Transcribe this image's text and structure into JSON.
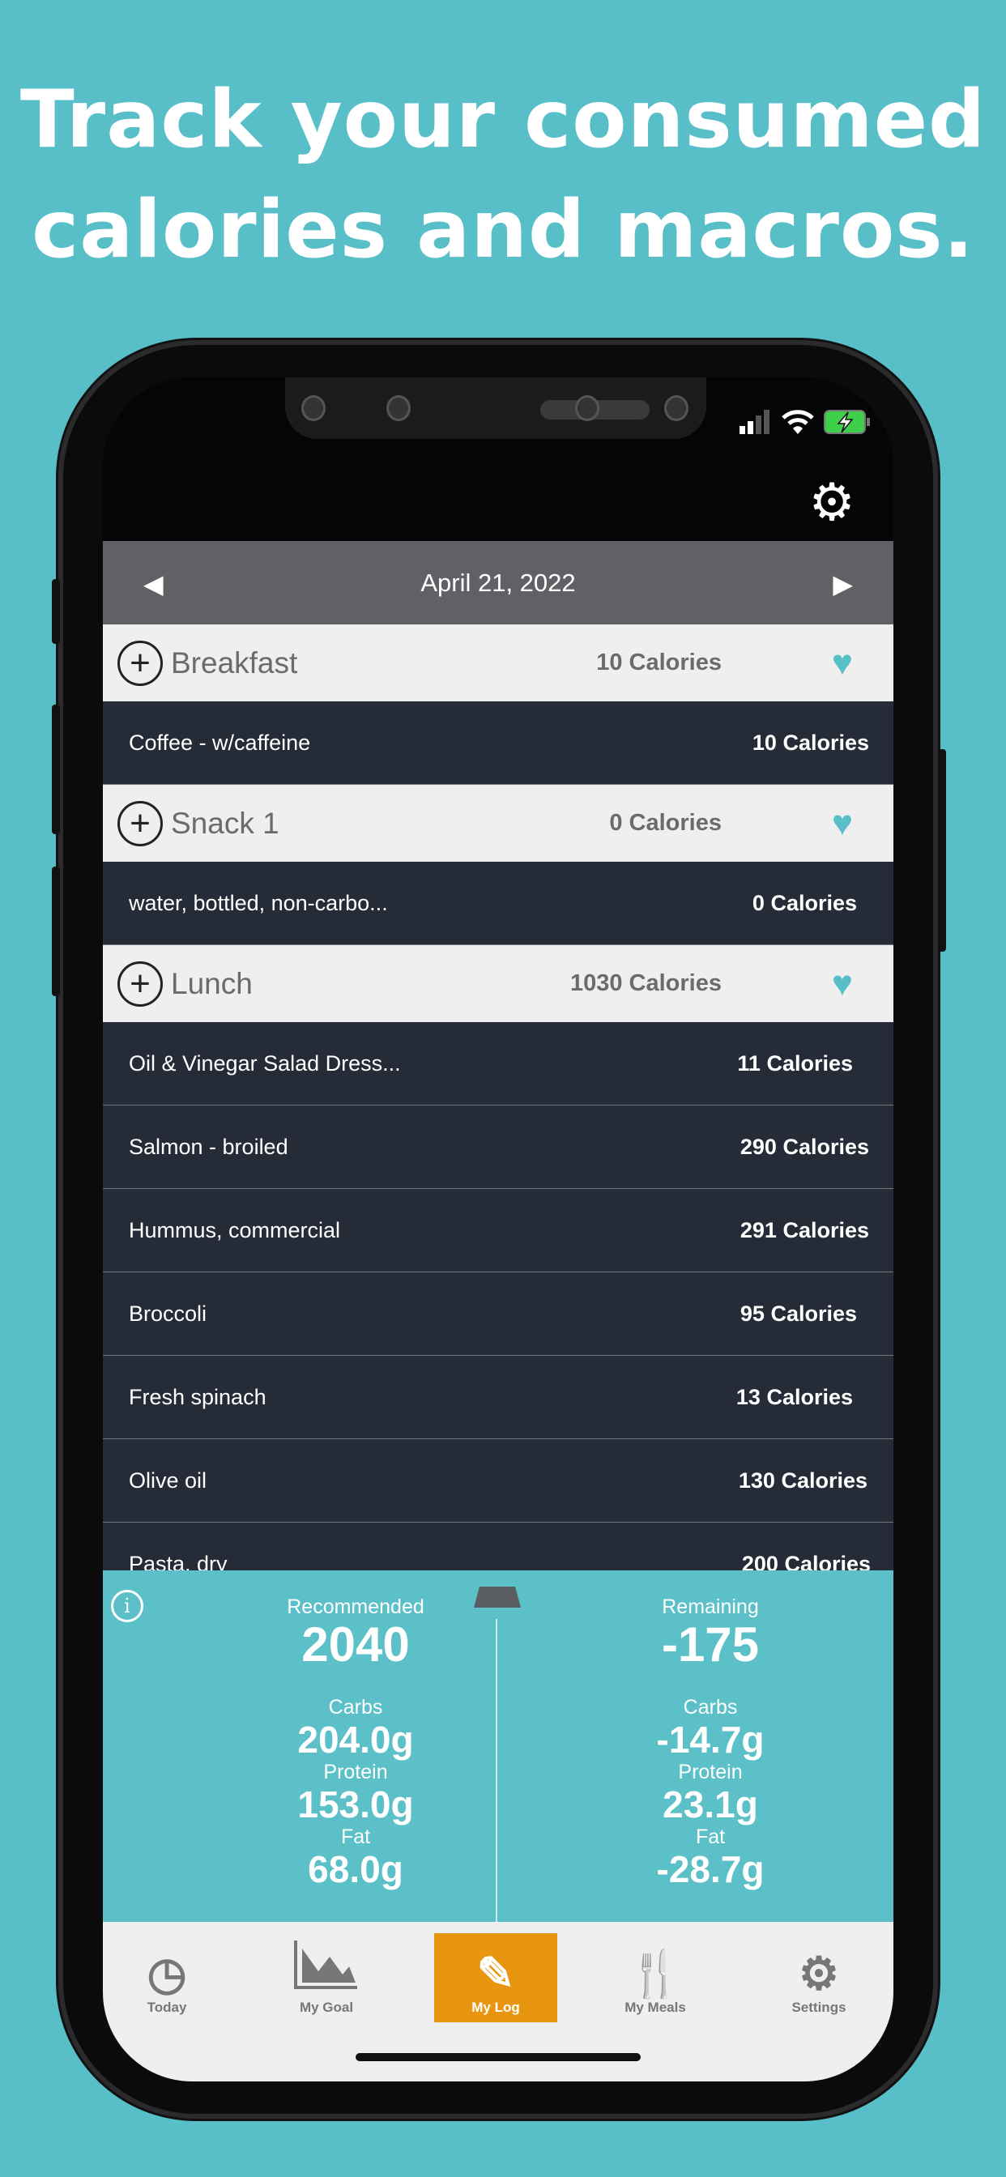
{
  "headline": {
    "line1": "Track your consumed",
    "line2": "calories and macros."
  },
  "header": {
    "date": "April 21, 2022"
  },
  "meals": [
    {
      "name": "Breakfast",
      "calories": "10 Calories",
      "items": [
        {
          "name": "Coffee - w/caffeine",
          "calories": "10 Calories"
        }
      ]
    },
    {
      "name": "Snack 1",
      "calories": "0 Calories",
      "items": [
        {
          "name": "water, bottled, non-carbo...",
          "calories": "0 Calories"
        }
      ]
    },
    {
      "name": "Lunch",
      "calories": "1030 Calories",
      "items": [
        {
          "name": "Oil & Vinegar Salad Dress...",
          "calories": "11 Calories"
        },
        {
          "name": "Salmon - broiled",
          "calories": "290 Calories"
        },
        {
          "name": "Hummus, commercial",
          "calories": "291 Calories"
        },
        {
          "name": "Broccoli",
          "calories": "95 Calories"
        },
        {
          "name": "Fresh spinach",
          "calories": "13 Calories"
        },
        {
          "name": "Olive oil",
          "calories": "130 Calories"
        },
        {
          "name": "Pasta, dry",
          "calories": "200 Calories"
        }
      ]
    }
  ],
  "summary": {
    "recommended": {
      "label": "Recommended",
      "value": "2040",
      "carbs_label": "Carbs",
      "carbs": "204.0g",
      "protein_label": "Protein",
      "protein": "153.0g",
      "fat_label": "Fat",
      "fat": "68.0g"
    },
    "remaining": {
      "label": "Remaining",
      "value": "-175",
      "carbs_label": "Carbs",
      "carbs": "-14.7g",
      "protein_label": "Protein",
      "protein": "23.1g",
      "fat_label": "Fat",
      "fat": "-28.7g"
    }
  },
  "nav": [
    {
      "label": "Today",
      "icon": "clock-icon"
    },
    {
      "label": "My Goal",
      "icon": "chart-icon"
    },
    {
      "label": "My Log",
      "icon": "notebook-pencil-icon",
      "active": true
    },
    {
      "label": "My Meals",
      "icon": "fork-knife-icon"
    },
    {
      "label": "Settings",
      "icon": "gear-icon"
    }
  ],
  "colors": {
    "background": "#58bfc8",
    "accent": "#e8960f",
    "row": "#252c37",
    "datebar": "#5f6165",
    "heart": "#58bfc8"
  }
}
